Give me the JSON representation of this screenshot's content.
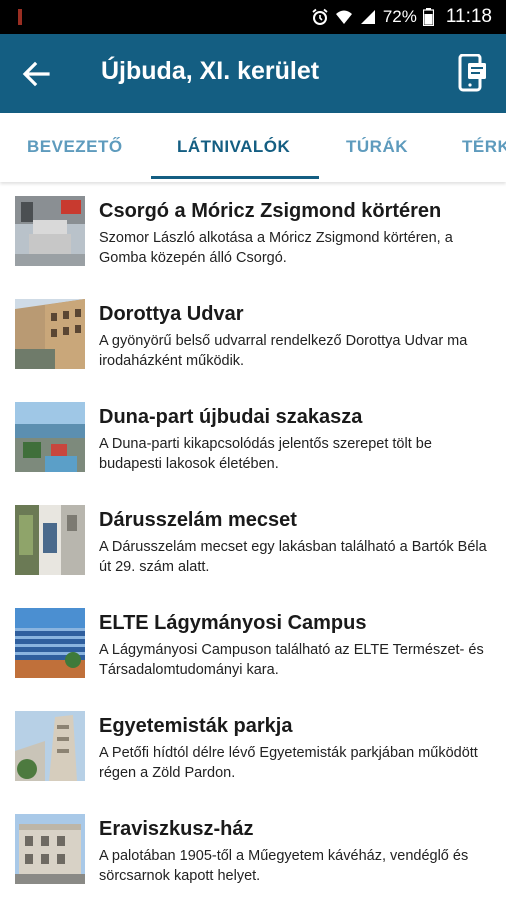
{
  "status_bar": {
    "battery_percent": "72%",
    "time": "11:18",
    "icons": [
      "alarm-icon",
      "wifi-icon",
      "signal-icon",
      "battery-icon"
    ]
  },
  "app_bar": {
    "title": "Újbuda, XI. kerület",
    "back_icon": "arrow-back-icon",
    "action_icon": "phone-document-icon",
    "color": "#145e82"
  },
  "tabs": [
    {
      "label": "BEVEZETŐ",
      "active": false
    },
    {
      "label": "LÁTNIVALÓK",
      "active": true
    },
    {
      "label": "TÚRÁK",
      "active": false
    },
    {
      "label": "TÉRKÉP",
      "active": false
    }
  ],
  "items": [
    {
      "title": "Csorgó a Móricz Zsigmond körtéren",
      "desc": "Szomor László alkotása a Móricz Zsigmond körtéren, a Gomba közepén álló Csorgó."
    },
    {
      "title": "Dorottya Udvar",
      "desc": "A gyönyörű belső udvarral rendelkező Dorottya Udvar ma irodaházként működik."
    },
    {
      "title": "Duna-part újbudai szakasza",
      "desc": "A Duna-parti kikapcsolódás jelentős szerepet tölt be budapesti lakosok életében."
    },
    {
      "title": "Dárusszelám mecset",
      "desc": "A Dárusszelám mecset egy lakásban található a Bartók Béla út 29. szám alatt."
    },
    {
      "title": "ELTE Lágymányosi Campus",
      "desc": "A Lágymányosi Campuson található az ELTE Természet- és Társadalomtudományi kara."
    },
    {
      "title": "Egyetemisták parkja",
      "desc": "A Petőfi hídtól délre lévő Egyetemisták parkjában működött régen a Zöld Pardon."
    },
    {
      "title": "Eraviszkusz-ház",
      "desc": "A palotában 1905-től a Műegyetem kávéház, vendéglő és sörcsarnok kapott helyet."
    }
  ]
}
